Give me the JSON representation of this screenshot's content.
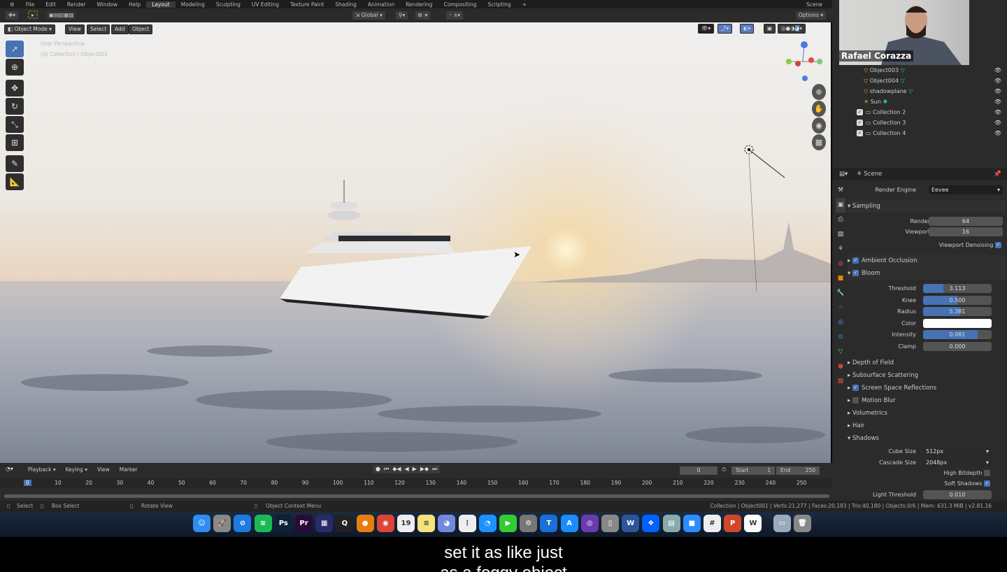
{
  "menu": [
    "File",
    "Edit",
    "Render",
    "Window",
    "Help"
  ],
  "workspaces": [
    "Layout",
    "Modeling",
    "Sculpting",
    "UV Editing",
    "Texture Paint",
    "Shading",
    "Animation",
    "Rendering",
    "Compositing",
    "Scripting",
    "+"
  ],
  "scene_label": "Scene",
  "tool_header": {
    "orientation": "Global",
    "options": "Options"
  },
  "viewport": {
    "mode": "Object Mode",
    "menus": [
      "View",
      "Select",
      "Add",
      "Object"
    ],
    "overlay_line1": "User Perspective",
    "overlay_line2": "(0) Collection | Object001"
  },
  "webcam": {
    "name": "Rafael Corazza"
  },
  "outliner": [
    {
      "name": "Object003",
      "icon": "mesh-icon"
    },
    {
      "name": "Object004",
      "icon": "mesh-icon"
    },
    {
      "name": "shadowplane",
      "icon": "mesh-icon"
    },
    {
      "name": "Sun",
      "icon": "light-icon"
    },
    {
      "name": "Collection 2",
      "icon": "collection-icon"
    },
    {
      "name": "Collection 3",
      "icon": "collection-icon"
    },
    {
      "name": "Collection 4",
      "icon": "collection-icon"
    }
  ],
  "properties": {
    "context": "Scene",
    "render_engine_label": "Render Engine",
    "render_engine": "Eevee",
    "sampling": "Sampling",
    "render_label": "Render",
    "render": "64",
    "viewport_label": "Viewport",
    "viewport": "16",
    "denoise_label": "Viewport Denoising",
    "ao": "Ambient Occlusion",
    "bloom": "Bloom",
    "bloom_fields": [
      {
        "label": "Threshold",
        "value": "3.113",
        "fill": 0.3
      },
      {
        "label": "Knee",
        "value": "0.500",
        "fill": 0.5
      },
      {
        "label": "Radius",
        "value": "5.381",
        "fill": 0.54
      },
      {
        "label": "Color",
        "value": ""
      },
      {
        "label": "Intensity",
        "value": "0.081",
        "fill": 0.8
      },
      {
        "label": "Clamp",
        "value": "0.000",
        "fill": 0
      }
    ],
    "sections": [
      "Depth of Field",
      "Subsurface Scattering",
      "Screen Space Reflections",
      "Motion Blur",
      "Volumetrics",
      "Hair",
      "Shadows"
    ],
    "cube_size_label": "Cube Size",
    "cube_size": "512px",
    "cascade_label": "Cascade Size",
    "cascade": "2048px",
    "high_bitdepth": "High Bitdepth",
    "soft_shadows": "Soft Shadows",
    "light_threshold": "Light Threshold",
    "light_threshold_value": "0.010"
  },
  "timeline": {
    "menus": [
      "Playback",
      "Keying",
      "View",
      "Marker"
    ],
    "current": "0",
    "start_label": "Start",
    "start": "1",
    "end_label": "End",
    "end": "250",
    "ticks": [
      "0",
      "10",
      "20",
      "30",
      "40",
      "50",
      "60",
      "70",
      "80",
      "90",
      "100",
      "110",
      "120",
      "130",
      "140",
      "150",
      "160",
      "170",
      "180",
      "190",
      "200",
      "210",
      "220",
      "230",
      "240",
      "250"
    ]
  },
  "status": {
    "select": "Select",
    "box": "Box Select",
    "rotate": "Rotate View",
    "context": "Object Context Menu",
    "info": "Collection | Object001 | Verts:21,277 | Faces:20,183 | Tris:40,180 | Objects:0/6 | Mem: 631.3 MiB | v2.81.16"
  },
  "dock": [
    {
      "name": "finder",
      "label": "☺",
      "color": "#2f8cf0"
    },
    {
      "name": "launchpad",
      "label": "🚀",
      "color": "#888"
    },
    {
      "name": "safari",
      "label": "⊘",
      "color": "#1f7ae0"
    },
    {
      "name": "spotify",
      "label": "≋",
      "color": "#1db954"
    },
    {
      "name": "photoshop",
      "label": "Ps",
      "color": "#0b2238"
    },
    {
      "name": "premiere",
      "label": "Pr",
      "color": "#2a0a3a"
    },
    {
      "name": "media-encoder",
      "label": "▦",
      "color": "#2a2a6a"
    },
    {
      "name": "quixel",
      "label": "Q",
      "color": "#222"
    },
    {
      "name": "blender",
      "label": "●",
      "color": "#e87d0d"
    },
    {
      "name": "chrome",
      "label": "◉",
      "color": "#db4437"
    },
    {
      "name": "calendar",
      "label": "19",
      "color": "#eee"
    },
    {
      "name": "notes",
      "label": "≡",
      "color": "#f5e27a"
    },
    {
      "name": "discord",
      "label": "◕",
      "color": "#7289da"
    },
    {
      "name": "reminders",
      "label": "⋮",
      "color": "#eee"
    },
    {
      "name": "messenger",
      "label": "◔",
      "color": "#1e90ff"
    },
    {
      "name": "facetime",
      "label": "▶",
      "color": "#3c3"
    },
    {
      "name": "system-preferences",
      "label": "⚙",
      "color": "#777"
    },
    {
      "name": "keynote",
      "label": "T",
      "color": "#1a6ed8"
    },
    {
      "name": "app-store",
      "label": "A",
      "color": "#1a8cff"
    },
    {
      "name": "siri",
      "label": "◎",
      "color": "#6a3ab0"
    },
    {
      "name": "files",
      "label": "▯",
      "color": "#888"
    },
    {
      "name": "word",
      "label": "W",
      "color": "#2b579a"
    },
    {
      "name": "dropbox",
      "label": "❖",
      "color": "#0061ff"
    },
    {
      "name": "preview",
      "label": "▤",
      "color": "#8aa"
    },
    {
      "name": "zoom",
      "label": "■",
      "color": "#2d8cff"
    },
    {
      "name": "slack",
      "label": "#",
      "color": "#eee"
    },
    {
      "name": "powerpoint",
      "label": "P",
      "color": "#d24726"
    },
    {
      "name": "webex",
      "label": "W",
      "color": "#fff"
    },
    {
      "name": "downloads",
      "label": "▭",
      "color": "#9ab"
    },
    {
      "name": "trash",
      "label": "🗑",
      "color": "#888"
    }
  ],
  "subtitles": [
    "set it as like just",
    "as a foggy object"
  ]
}
